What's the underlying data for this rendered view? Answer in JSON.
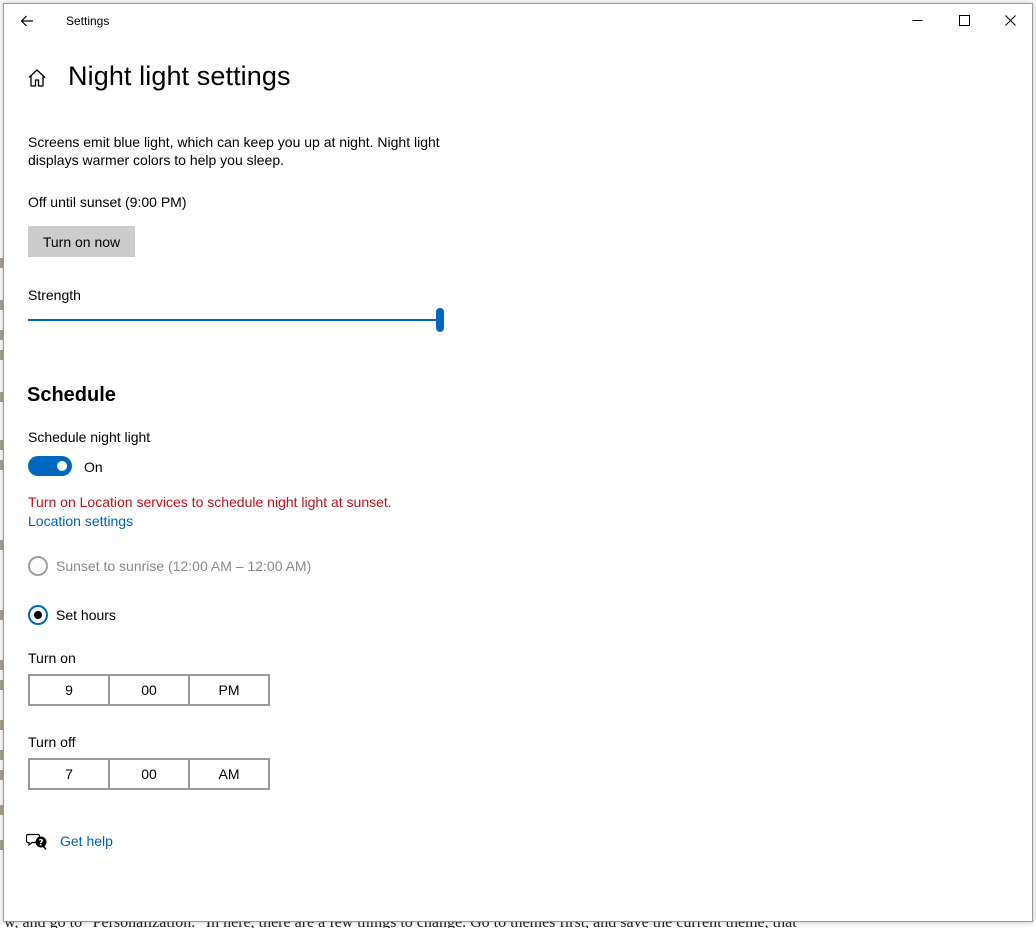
{
  "background": {
    "bottom_text": "w, and go to \"Personalization.\" In here, there are a few things to change. Go to themes first, and save the current theme, that"
  },
  "titlebar": {
    "title": "Settings",
    "back_icon": "arrow-left-icon",
    "minimize_icon": "minimize-icon",
    "maximize_icon": "maximize-icon",
    "close_icon": "close-icon"
  },
  "header": {
    "home_icon": "home-icon",
    "title": "Night light settings"
  },
  "night_light": {
    "description": "Screens emit blue light, which can keep you up at night. Night light displays warmer colors to help you sleep.",
    "status": "Off until sunset (9:00 PM)",
    "turn_on_label": "Turn on now",
    "strength_label": "Strength",
    "strength_value": 1.0
  },
  "schedule": {
    "heading": "Schedule",
    "toggle_label": "Schedule night light",
    "toggle_state": "On",
    "warning": "Turn on Location services to schedule night light at sunset.",
    "location_link": "Location settings",
    "options": [
      {
        "label": "Sunset to sunrise (12:00 AM – 12:00 AM)",
        "checked": false,
        "disabled": true
      },
      {
        "label": "Set hours",
        "checked": true,
        "disabled": false
      }
    ],
    "turn_on": {
      "label": "Turn on",
      "hour": "9",
      "minute": "00",
      "period": "PM"
    },
    "turn_off": {
      "label": "Turn off",
      "hour": "7",
      "minute": "00",
      "period": "AM"
    }
  },
  "footer": {
    "help_icon": "chat-help-icon",
    "help_label": "Get help"
  },
  "colors": {
    "accent": "#0067c0",
    "link": "#0063b1",
    "warning": "#c50f1f",
    "button_bg": "#cccccc"
  }
}
